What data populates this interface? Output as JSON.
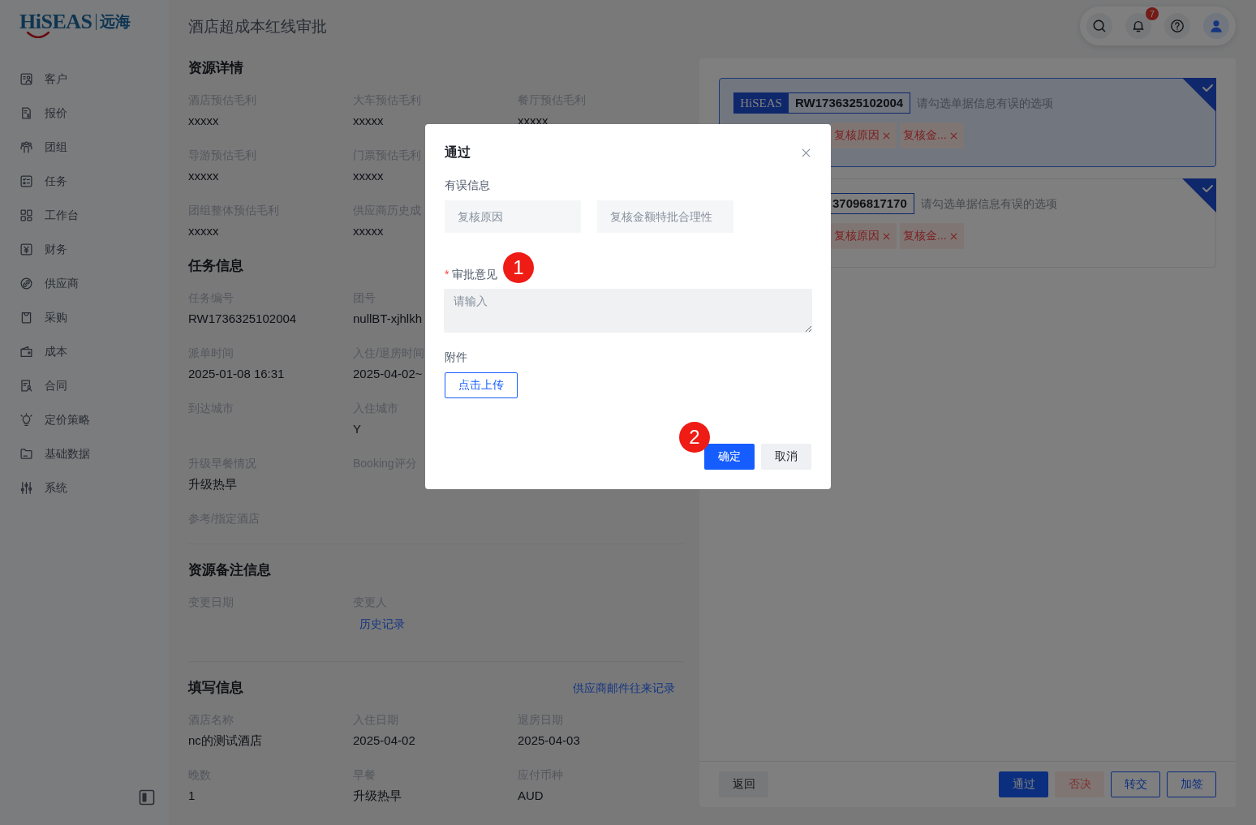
{
  "sidebar": {
    "logo": {
      "text": "HiSEAS",
      "cn": "远海"
    },
    "items": [
      {
        "label": "客户",
        "selected": false
      },
      {
        "label": "报价",
        "selected": false
      },
      {
        "label": "团组",
        "selected": false
      },
      {
        "label": "任务",
        "selected": false
      },
      {
        "label": "工作台",
        "selected": false
      },
      {
        "label": "财务",
        "selected": false
      },
      {
        "label": "供应商",
        "selected": false
      },
      {
        "label": "采购",
        "selected": false
      },
      {
        "label": "成本",
        "selected": false
      },
      {
        "label": "合同",
        "selected": false
      },
      {
        "label": "定价策略",
        "selected": false
      },
      {
        "label": "基础数据",
        "selected": false
      },
      {
        "label": "系统",
        "selected": false
      }
    ]
  },
  "page_title": "酒店超成本红线审批",
  "toolbar": {
    "notification_count": "7"
  },
  "sections": [
    {
      "title": "资源详情",
      "divider": false,
      "rows": [
        [
          {
            "label": "酒店预估毛利",
            "value": "xxxxx"
          },
          {
            "label": "大车预估毛利",
            "value": "xxxxx"
          },
          {
            "label": "餐厅预估毛利",
            "value": "xxxxx"
          }
        ],
        [
          {
            "label": "导游预估毛利",
            "value": "xxxxx"
          },
          {
            "label": "门票预估毛利",
            "value": "xxxxx"
          }
        ],
        [
          {
            "label": "团组整体预估毛利",
            "value": "xxxxx"
          },
          {
            "label": "供应商历史成",
            "value": "xxxxx"
          }
        ]
      ]
    },
    {
      "title": "任务信息",
      "divider": false,
      "rows": [
        [
          {
            "label": "任务编号",
            "value": "RW1736325102004"
          },
          {
            "label": "团号",
            "value": "nullBT-xjhlkh"
          }
        ],
        [
          {
            "label": "派单时间",
            "value": "2025-01-08 16:31"
          },
          {
            "label": "入住/退房时间",
            "value": "2025-04-02~"
          }
        ],
        [
          {
            "label": "到达城市"
          },
          {
            "label": "入住城市",
            "value": "Y"
          }
        ],
        [
          {
            "label": "升级早餐情况",
            "value": "升级热早"
          },
          {
            "label": "Booking评分"
          }
        ],
        [
          {
            "label": "参考/指定酒店"
          }
        ]
      ]
    },
    {
      "title": "资源备注信息",
      "divider": true,
      "rows": [
        [
          {
            "label": "变更日期"
          },
          {
            "label": "变更人",
            "link": "历史记录"
          }
        ]
      ]
    },
    {
      "title": "填写信息",
      "divider": true,
      "link": "供应商邮件往来记录",
      "rows": [
        [
          {
            "label": "酒店名称",
            "value": "nc的测试酒店"
          },
          {
            "label": "入住日期",
            "value": "2025-04-02"
          },
          {
            "label": "退房日期",
            "value": "2025-04-03"
          }
        ],
        [
          {
            "label": "晚数",
            "value": "1"
          },
          {
            "label": "早餐",
            "value": "升级热早"
          },
          {
            "label": "应付币种",
            "value": "AUD"
          }
        ]
      ]
    }
  ],
  "review_cards": [
    {
      "logo": "HiSEAS",
      "id": "RW1736325102004",
      "hint": "请勾选单据信息有误的选项",
      "selected": true,
      "checked": true,
      "tags": [
        "复核原因",
        "复核金..."
      ]
    },
    {
      "id": "37096817170",
      "hint": "请勾选单据信息有误的选项",
      "selected": false,
      "checked": true,
      "tags": [
        "复核原因",
        "复核金..."
      ]
    }
  ],
  "back_button": {
    "label": "返回"
  },
  "actions": [
    {
      "label": "通过",
      "kind": "primary"
    },
    {
      "label": "否决",
      "kind": "danger"
    },
    {
      "label": "转交",
      "kind": "outline"
    },
    {
      "label": "加签",
      "kind": "outline"
    }
  ],
  "modal": {
    "title": "通过",
    "error_info": {
      "label": "有误信息",
      "items": [
        "复核原因",
        "复核金额特批合理性"
      ]
    },
    "comment": {
      "label": "审批意见",
      "required_mark": "*",
      "placeholder": "请输入"
    },
    "attachment": {
      "label": "附件",
      "button": "点击上传"
    },
    "buttons": [
      {
        "label": "确定",
        "kind": "primary"
      },
      {
        "label": "取消",
        "kind": "default"
      }
    ],
    "markers": [
      {
        "label": "1"
      },
      {
        "label": "2"
      }
    ]
  }
}
